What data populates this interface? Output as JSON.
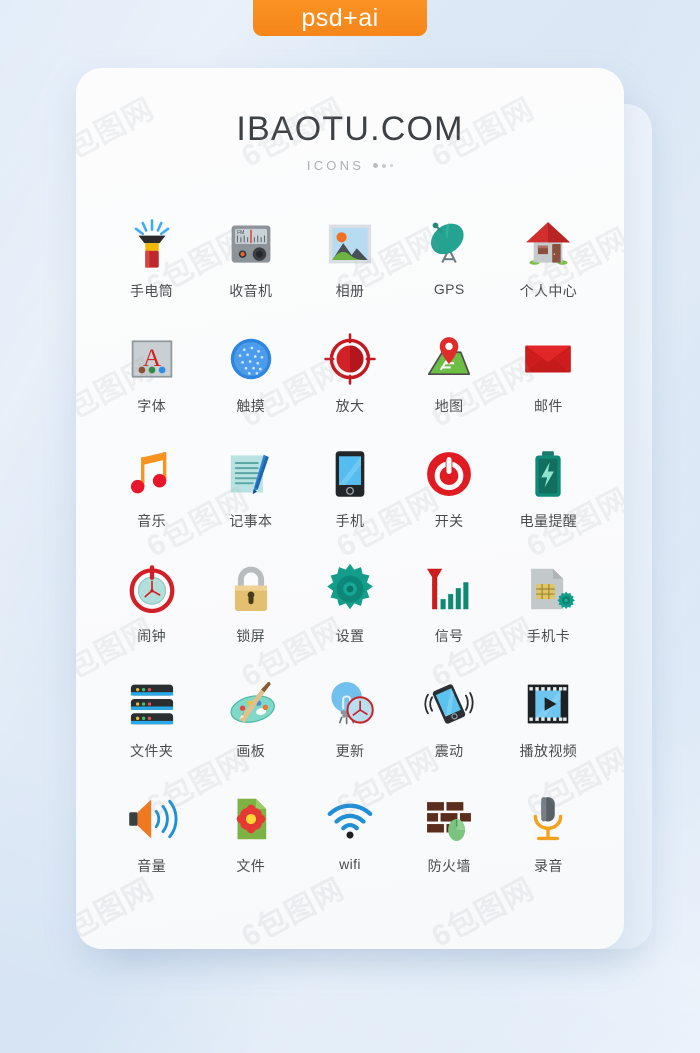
{
  "badge": {
    "label": "psd+ai",
    "color": "#f5861a"
  },
  "card": {
    "title": "IBAOTU.COM",
    "subtitle": "ICONS"
  },
  "watermark": {
    "text": "6包图网"
  },
  "grid": {
    "columns": 5,
    "items": [
      {
        "id": "flashlight",
        "icon": "flashlight-icon",
        "label": "手电筒"
      },
      {
        "id": "radio",
        "icon": "radio-icon",
        "label": "收音机"
      },
      {
        "id": "photo-album",
        "icon": "photo-album-icon",
        "label": "相册"
      },
      {
        "id": "gps",
        "icon": "satellite-dish-icon",
        "label": "GPS"
      },
      {
        "id": "personal-center",
        "icon": "house-icon",
        "label": "个人中心"
      },
      {
        "id": "font",
        "icon": "font-icon",
        "label": "字体"
      },
      {
        "id": "touch",
        "icon": "touch-icon",
        "label": "触摸"
      },
      {
        "id": "zoom-in",
        "icon": "target-icon",
        "label": "放大"
      },
      {
        "id": "map",
        "icon": "map-pin-icon",
        "label": "地图"
      },
      {
        "id": "mail",
        "icon": "envelope-icon",
        "label": "邮件"
      },
      {
        "id": "music",
        "icon": "music-note-icon",
        "label": "音乐"
      },
      {
        "id": "notepad",
        "icon": "notepad-pen-icon",
        "label": "记事本"
      },
      {
        "id": "phone",
        "icon": "smartphone-icon",
        "label": "手机"
      },
      {
        "id": "power",
        "icon": "power-icon",
        "label": "开关"
      },
      {
        "id": "battery-alert",
        "icon": "battery-bolt-icon",
        "label": "电量提醒"
      },
      {
        "id": "alarm",
        "icon": "alarm-clock-icon",
        "label": "闹钟"
      },
      {
        "id": "lock-screen",
        "icon": "padlock-icon",
        "label": "锁屏"
      },
      {
        "id": "settings",
        "icon": "gear-icon",
        "label": "设置"
      },
      {
        "id": "signal",
        "icon": "signal-bars-icon",
        "label": "信号"
      },
      {
        "id": "sim-card",
        "icon": "sim-card-gear-icon",
        "label": "手机卡"
      },
      {
        "id": "folder",
        "icon": "server-stack-icon",
        "label": "文件夹"
      },
      {
        "id": "drawing-board",
        "icon": "palette-brush-icon",
        "label": "画板"
      },
      {
        "id": "update",
        "icon": "bulb-clock-icon",
        "label": "更新"
      },
      {
        "id": "vibrate",
        "icon": "vibrate-phone-icon",
        "label": "震动"
      },
      {
        "id": "play-video",
        "icon": "film-play-icon",
        "label": "播放视频"
      },
      {
        "id": "volume",
        "icon": "speaker-waves-icon",
        "label": "音量"
      },
      {
        "id": "file",
        "icon": "flower-file-icon",
        "label": "文件"
      },
      {
        "id": "wifi",
        "icon": "wifi-icon",
        "label": "wifi"
      },
      {
        "id": "firewall",
        "icon": "brick-wall-mouse-icon",
        "label": "防火墙"
      },
      {
        "id": "voice-record",
        "icon": "microphone-icon",
        "label": "录音"
      }
    ]
  }
}
